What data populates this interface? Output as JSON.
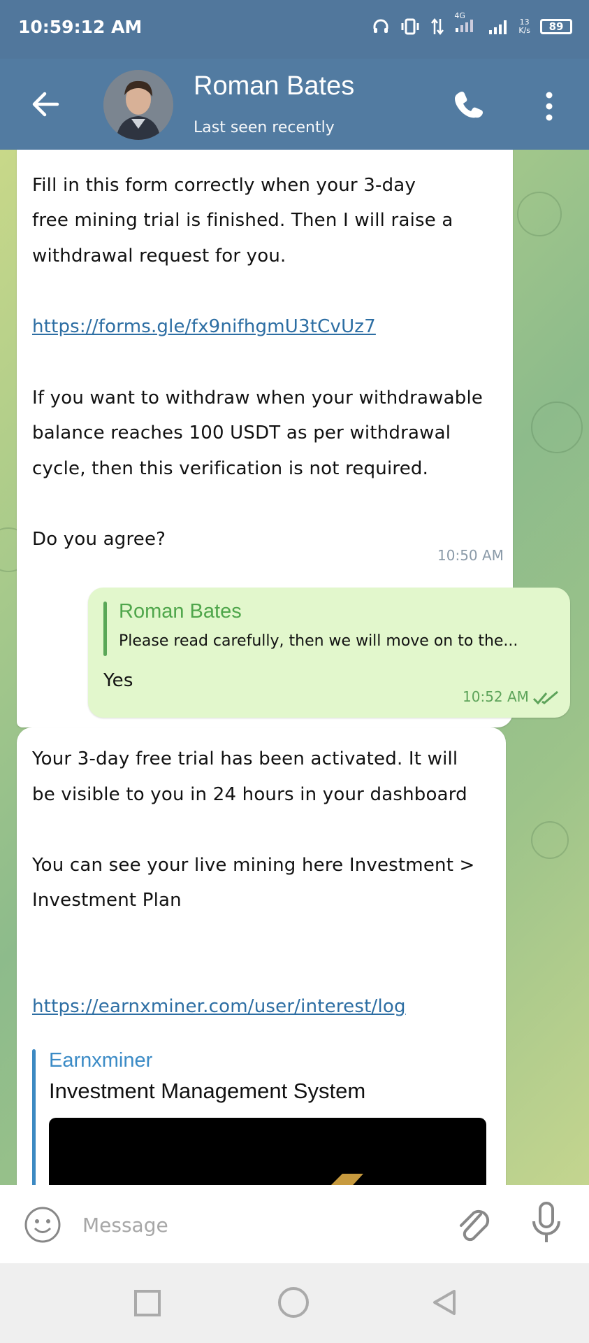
{
  "status": {
    "time": "10:59:12 AM",
    "net_top": "4G",
    "speed_top": "13",
    "speed_unit": "K/s",
    "battery": "89"
  },
  "header": {
    "contact_name": "Roman Bates",
    "status": "Last seen recently"
  },
  "messages": [
    {
      "lines": [
        "Fill in this form correctly when your 3-day",
        "free mining trial is finished. Then I will raise a",
        "withdrawal request for you.",
        "https://forms.gle/fx9nifhgmU3tCvUz7",
        "If you want to withdraw when your withdrawable",
        "balance reaches 100 USDT as per withdrawal",
        "cycle, then this verification is not required.",
        "Do you agree?"
      ],
      "time": "10:50 AM"
    },
    {
      "reply_name": "Roman Bates",
      "reply_text": "Please read carefully, then we will move on to the...",
      "text": "Yes",
      "time": "10:52 AM"
    },
    {
      "lines": [
        "Your 3-day free trial has been activated. It will",
        "be visible to you in 24 hours in your dashboard",
        "You can see your live mining here Investment >",
        "Investment Plan",
        "https://earnxminer.com/user/interest/log"
      ],
      "preview_site": "Earnxminer",
      "preview_title": "Investment Management System"
    }
  ],
  "input": {
    "placeholder": "Message"
  },
  "colors": {
    "header": "#527ba1",
    "outgoing_bubble": "#e2f7cc",
    "link": "#2d6ea3",
    "accent_green": "#4fa64b"
  }
}
